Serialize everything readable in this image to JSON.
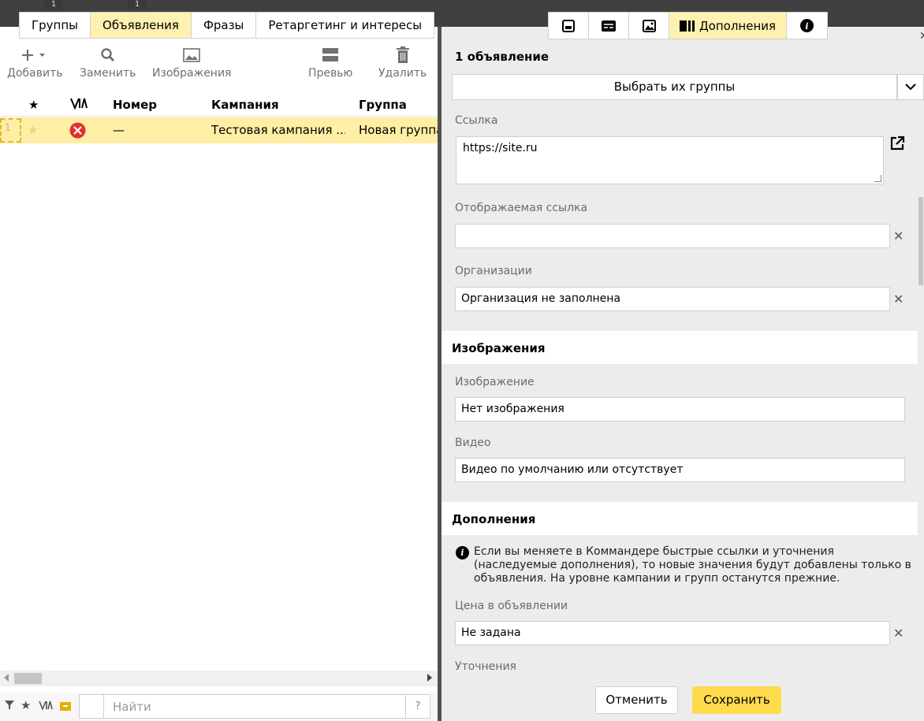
{
  "left_tabs": {
    "counts": [
      "1",
      "1"
    ],
    "items": [
      {
        "label": "Группы"
      },
      {
        "label": "Объявления"
      },
      {
        "label": "Фразы"
      },
      {
        "label": "Ретаргетинг и интересы"
      }
    ]
  },
  "toolbar": {
    "add": "Добавить",
    "replace": "Заменить",
    "images": "Изображения",
    "preview": "Превью",
    "delete": "Удалить"
  },
  "grid": {
    "headers": {
      "number": "Номер",
      "campaign": "Кампания",
      "group": "Группа"
    },
    "rows": [
      {
        "index": "1",
        "number": "—",
        "campaign": "Тестовая кампания ...",
        "group": "Новая группа"
      }
    ]
  },
  "search": {
    "placeholder": "Найти",
    "help": "?"
  },
  "right_tabs": {
    "extras": "Дополнения"
  },
  "panel": {
    "ad_count": "1 объявление",
    "choose_groups": "Выбрать их группы",
    "link_label": "Ссылка",
    "link_value": "https://site.ru",
    "display_link_label": "Отображаемая ссылка",
    "display_link_value": "",
    "org_label": "Организации",
    "org_value": "Организация не заполнена",
    "images_section": "Изображения",
    "image_label": "Изображение",
    "image_value": "Нет изображения",
    "video_label": "Видео",
    "video_value": "Видео по умолчанию или отсутствует",
    "extras_section": "Дополнения",
    "info_text": "Если вы меняете в Коммандере быстрые ссылки и уточнения (наследуемые дополнения), то новые значения будут добавлены только в объявления. На уровне кампании и групп останутся прежние.",
    "price_label": "Цена в объявлении",
    "price_value": "Не задана",
    "callouts_label": "Уточнения"
  },
  "footer": {
    "cancel": "Отменить",
    "save": "Сохранить"
  },
  "colors": {
    "accent_yellow": "#ffdb4d",
    "active_tab": "#fff1b0",
    "row_selected": "#ffeea5",
    "error_red": "#e0332d"
  }
}
